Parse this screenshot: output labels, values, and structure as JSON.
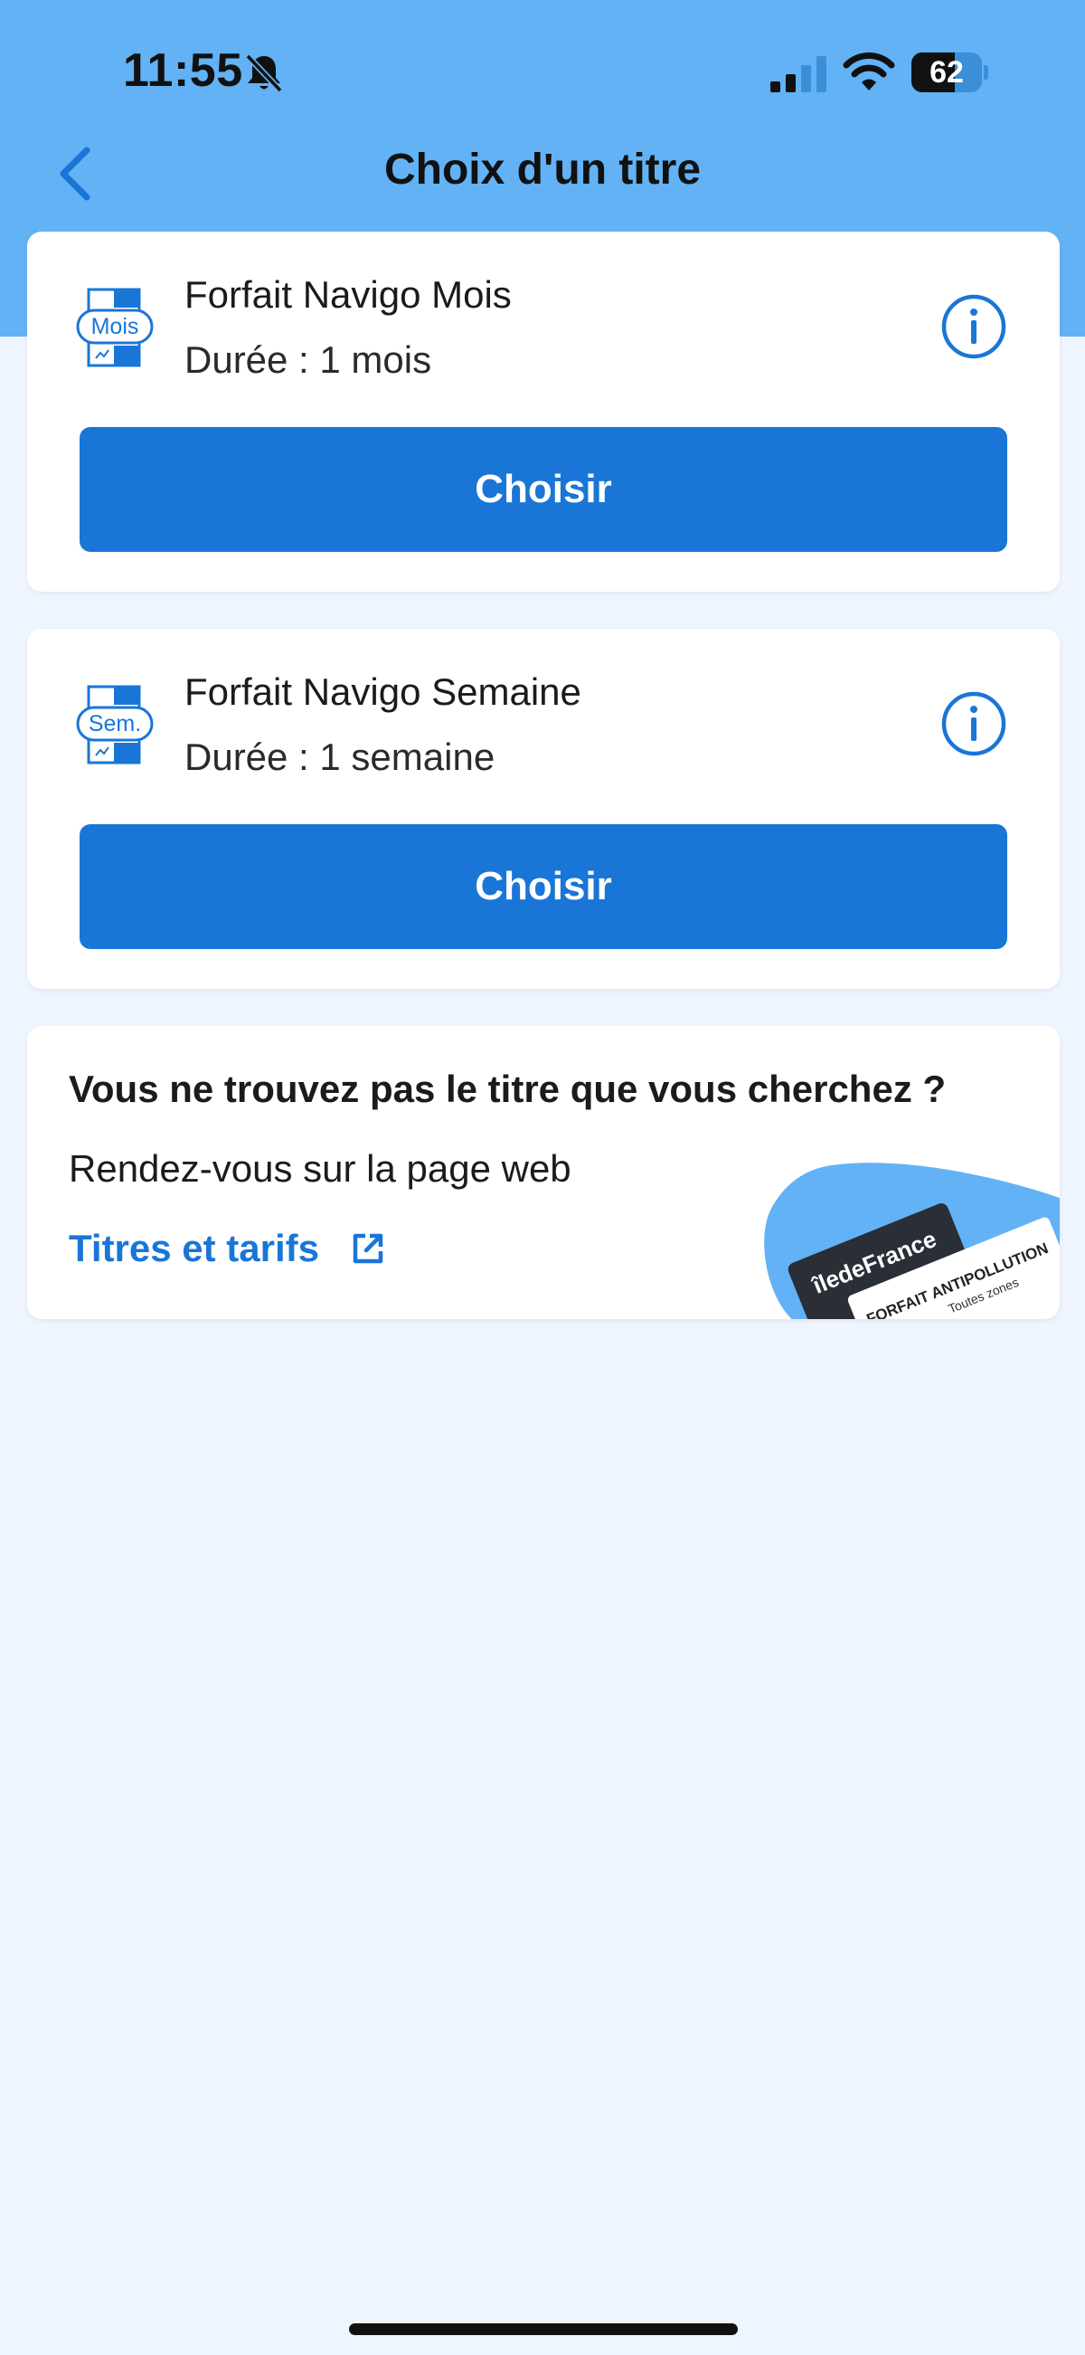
{
  "status_bar": {
    "time": "11:55",
    "battery_level": "62",
    "battery_fraction": 0.62
  },
  "nav": {
    "title": "Choix d'un titre"
  },
  "tickets": [
    {
      "icon_label": "Mois",
      "name": "Forfait Navigo Mois",
      "duration": "Durée : 1 mois",
      "button_label": "Choisir"
    },
    {
      "icon_label": "Sem.",
      "name": "Forfait Navigo Semaine",
      "duration": "Durée : 1 semaine",
      "button_label": "Choisir"
    }
  ],
  "help": {
    "title": "Vous ne trouvez pas le titre que vous cherchez ?",
    "text": "Rendez-vous sur la page web",
    "link_label": "Titres et tarifs",
    "illustration_brand": "îledeFrance",
    "illustration_ticket_title": "FORFAIT ANTIPOLLUTION",
    "illustration_ticket_subtitle": "Toutes zones"
  },
  "colors": {
    "header": "#62B2F5",
    "background": "#EEF5FE",
    "primary": "#1976D7"
  },
  "icons": {
    "back": "chevron-left-icon",
    "info": "info-circle-icon",
    "external_link": "external-link-icon",
    "notifications_muted": "bell-slash-icon"
  }
}
